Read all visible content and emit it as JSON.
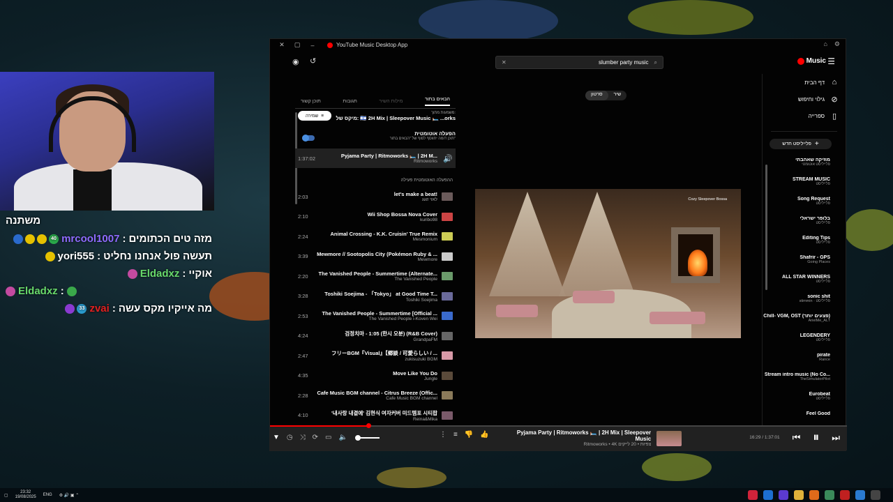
{
  "chat": {
    "standalone": "משתנה",
    "lines": [
      {
        "user": "mrcool1007",
        "user_color": "#8f6bff",
        "msg": "מזה טים הכתומים"
      },
      {
        "user": "yori555",
        "user_color": "#ffffff",
        "msg": "תעשה פול אנחנו נחליט"
      },
      {
        "user": "Eldadxz",
        "user_color": "#68d96b",
        "msg": "אוקיי"
      },
      {
        "user": "Eldadxz",
        "user_color": "#68d96b",
        "msg": ""
      },
      {
        "user": "zvai",
        "user_color": "#e02020",
        "msg": "מה אייקיו מקס עשה"
      }
    ],
    "badge_count": "40",
    "badge_count2": "33"
  },
  "window": {
    "title": "YouTube Music Desktop App"
  },
  "search": {
    "value": "slumber party music"
  },
  "brand": "Music",
  "sidebar": {
    "nav": [
      {
        "label": "דף הבית",
        "icon": "home-icon",
        "glyph": "⌂"
      },
      {
        "label": "גילוי וחיפוש",
        "icon": "explore-icon",
        "glyph": "⊘"
      },
      {
        "label": "ספרייה",
        "icon": "library-icon",
        "glyph": "▯"
      }
    ],
    "new_playlist": "פלייליסט חדש",
    "playlists": [
      {
        "name": "מוזיקה שאהבתי",
        "sub": "פלייליסט אוטומטי"
      },
      {
        "name": "STREAM MUSIC",
        "sub": "פלייליסט"
      },
      {
        "name": "Song Request",
        "sub": "פלייליסט"
      },
      {
        "name": "בלופר ישראלי",
        "sub": "פלייליסט"
      },
      {
        "name": "Editing Tips",
        "sub": "פלייליסט"
      },
      {
        "name": "Shafrir - GPS",
        "sub": "Going Places"
      },
      {
        "name": "ALL STAR WINNERS",
        "sub": "פלייליסט"
      },
      {
        "name": "sonic shit",
        "sub": "stimmin · פלייליסט"
      },
      {
        "name": "Chill- VGM, OST (פצעים יותר)",
        "sub": "ArielMe_ALT"
      },
      {
        "name": "LEGENDERY",
        "sub": "פלייליסט"
      },
      {
        "name": "pirate",
        "sub": "Rance"
      },
      {
        "name": "Stream intro music (No Co...",
        "sub": "TheSimulatorPilot"
      },
      {
        "name": "Eurobeat",
        "sub": "פלייליסט"
      },
      {
        "name": "Feel Good",
        "sub": ""
      }
    ]
  },
  "toggle": {
    "song": "שיר",
    "video": "סרטון"
  },
  "video": {
    "label": "Cozy Sleepover Bossa"
  },
  "queue": {
    "tabs": [
      "הבאים בתור",
      "מילות השיר",
      "תגובות",
      "תוכן קשור"
    ],
    "playing_from_label": "משמעות מתוך:",
    "playing_from_title": "מיקס של: 🇮🇱 2H Mix | Sleepover Music 🛏️ ...orks",
    "save": "שמירה",
    "autoplay_title": "הפעלה אוטומטית",
    "autoplay_sub": "תוכן דומה יתווסף לסוף של \"הבאים בתור\"",
    "current": {
      "dur": "1:37:02",
      "title": "Pyjama Party | Ritmoworks 🛏️ | 2H M...",
      "artist": "Ritmoworks"
    },
    "autoplay_label": "ההפעלה האוטומטית פעילה",
    "items": [
      {
        "dur": "2:03",
        "title": "let's make a beat!",
        "artist": "לאוי זוגג",
        "thumb": "#6a5a5a"
      },
      {
        "dur": "2:10",
        "title": "Wii Shop Bossa Nova Cover",
        "artist": "kuribo98",
        "thumb": "#c44"
      },
      {
        "dur": "2:24",
        "title": "Animal Crossing - K.K. Cruisin' True Remix",
        "artist": "Mesmonium",
        "thumb": "#cc5"
      },
      {
        "dur": "3:39",
        "title": "Mewmore // Sootopolis City (Pokémon Ruby & ...",
        "artist": "Mewmore",
        "thumb": "#ccc"
      },
      {
        "dur": "2:20",
        "title": "The Vanished People - Summertime (Alternate...",
        "artist": "The Vanished People",
        "thumb": "#6a9a6a"
      },
      {
        "dur": "3:28",
        "title": "Toshiki Soejima - 「Tokyo」 at Good Time T...",
        "artist": "Toshiki Soejima",
        "thumb": "#6a6a9a"
      },
      {
        "dur": "2:53",
        "title": "The Vanished People - Summertime [Official ...",
        "artist": "The Vanished People i-Koven Wei",
        "thumb": "#3a6acc"
      },
      {
        "dur": "4:24",
        "title": "검정치마 - 1:05 (한시 오분) (R&B Cover)",
        "artist": "GrandpaFM",
        "thumb": "#666"
      },
      {
        "dur": "2:47",
        "title": "フリーBGM『Visual』【郷談 / 可愛らしい / ...",
        "artist": "zukisuzuki BGM",
        "thumb": "#d89aa8"
      },
      {
        "dur": "4:35",
        "title": "Move Like You Do",
        "artist": "Jungle",
        "thumb": "#5a4a3a"
      },
      {
        "dur": "2:28",
        "title": "Cafe Music BGM channel - Citrus Breeze (Offic...",
        "artist": "Cafe Music BGM channel",
        "thumb": "#8a7a5a"
      },
      {
        "dur": "4:10",
        "title": "'내사랑 내곁에' 김현식 여자커버 미드템포 시티팝",
        "artist": "Reina&Mika",
        "thumb": "#7a5a6a"
      }
    ]
  },
  "player": {
    "title": "Pyjama Party | Ritmoworks 🛏️ | 2H Mix | Sleepover Music",
    "sub": "Ritmoworks • 4K צפיות • 20 לייקים",
    "time": "16:29 / 1:37:01",
    "progress": 0.17,
    "volume": 0.1
  },
  "taskbar": {
    "lang": "ENG",
    "time": "23:32",
    "date": "19/08/2025"
  }
}
